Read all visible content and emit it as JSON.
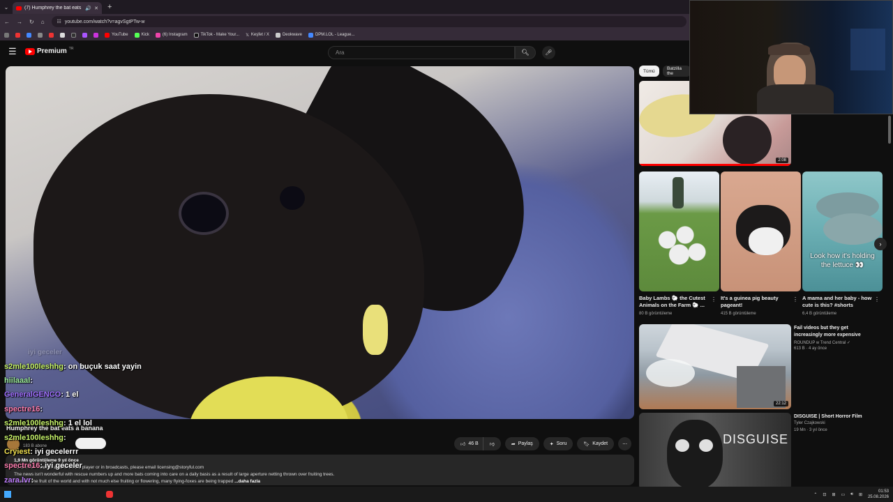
{
  "browser": {
    "tab_title": "(7) Humphrey the bat eats",
    "url": "youtube.com/watch?v=agvSgtPTw-w",
    "bookmarks": [
      "YouTube",
      "Kick",
      "(6) Instagram",
      "TikTok - Make Your...",
      "Keşfet / X",
      "Deokwave",
      "DPM.LOL - League..."
    ]
  },
  "youtube": {
    "logo": "Premium",
    "logo_sup": "TR",
    "search_placeholder": "Ara"
  },
  "video": {
    "title": "Humphrey the bat eats a banana",
    "subscribers": "183 B abone",
    "likes": "46 B",
    "share": "Paylaş",
    "ask": "Soru",
    "save": "Kaydet",
    "views": "1,9 Mn görüntüleme  9 yıl önce",
    "desc1": "To use this video in a commercial player or in broadcasts, please email licensing@storyful.com",
    "desc2": "The news isn't wonderful with rescue numbers up and more bats coming into care on a daily basis as a result of large aperture netting thrown over fruiting trees.",
    "desc3": "This are the fruit of the world and with not much else fruiting or flowering, many flying-foxes are being trapped",
    "more": "...daha fazla"
  },
  "chat": [
    {
      "name": "s2mle100leshhg",
      "msg": ": on buçuk saat yayin",
      "color": "#c8f56a"
    },
    {
      "name": "hiilaaal",
      "msg": ":",
      "color": "#a0f0a0"
    },
    {
      "name": "GeneralGENCO",
      "msg": ": 1 el",
      "color": "#a070ff"
    },
    {
      "name": "spectre16",
      "msg": ":",
      "color": "#ff7fb0"
    },
    {
      "name": "s2mle100leshhg",
      "msg": ": 1 el lol",
      "color": "#c8f56a"
    },
    {
      "name": "s2mle100leshhg",
      "msg": ":",
      "color": "#c8f56a"
    },
    {
      "name": "Cryiest",
      "msg": ": iyi gecelerrr",
      "color": "#f0e050"
    },
    {
      "name": "spectre16",
      "msg": ": iyi geceler",
      "color": "#ff7fb0"
    },
    {
      "name": "zara.lvr",
      "msg": ":",
      "color": "#c080ff"
    },
    {
      "name": "PrimusAstrum",
      "msg": " yeyyy",
      "color": "#ffffff"
    }
  ],
  "chat_faded": "iyi geceler",
  "sidebar": {
    "chips": [
      "Tümü",
      "Batzilla the"
    ],
    "top_duration": "2:08",
    "shorts": [
      {
        "title": "Baby Lambs 🐑 the Cutest Animals on the Farm 🐑 ...",
        "views": "80 B görüntüleme",
        "overlay": ""
      },
      {
        "title": "It's a guinea pig beauty pageant!",
        "views": "415 B görüntüleme",
        "overlay": ""
      },
      {
        "title": "A mama and her baby - how cute is this? #shorts",
        "views": "6,4 B görüntüleme",
        "overlay": "Look how it's holding the lettuce 👀"
      }
    ],
    "videos": [
      {
        "title": "Fail videos but they get increasingly more expensive",
        "channel": "ROUNDUP w Trend Central ✓",
        "meta": "613 B · 4 ay önce",
        "duration": "22:12"
      },
      {
        "title": "DISGUISE | Short Horror Film",
        "channel": "Tyler Czajkowski",
        "meta": "19 Mn · 3 yıl önce",
        "duration": "",
        "overlay": "DISGUISE"
      }
    ]
  },
  "taskbar": {
    "time": "01:53",
    "date": "25.08.2026"
  },
  "colors": {
    "yt_red": "#ff0000",
    "bg": "#0f0f0f",
    "accent": "#3ea6ff"
  }
}
